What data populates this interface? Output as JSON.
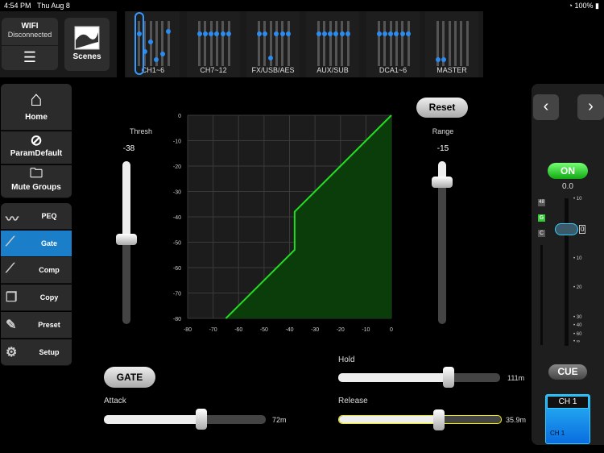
{
  "status": {
    "time": "4:54 PM",
    "date": "Thu Aug 8",
    "battery": "100%"
  },
  "top": {
    "wifi_title": "WIFI",
    "wifi_status": "Disconnected",
    "scenes": "Scenes",
    "groups": [
      {
        "label": "CH1~6",
        "levels": [
          0.75,
          0.3,
          0.55,
          0.1,
          0.25,
          0.8
        ]
      },
      {
        "label": "CH7~12",
        "levels": [
          0.75,
          0.75,
          0.75,
          0.75,
          0.75,
          0.75
        ]
      },
      {
        "label": "FX/USB/AES",
        "levels": [
          0.75,
          0.75,
          0.15,
          0.75,
          0.75,
          0.75
        ]
      },
      {
        "label": "AUX/SUB",
        "levels": [
          0.75,
          0.75,
          0.75,
          0.75,
          0.75,
          0.75
        ]
      },
      {
        "label": "DCA1~6",
        "levels": [
          0.75,
          0.75,
          0.75,
          0.75,
          0.75,
          0.75
        ]
      },
      {
        "label": "MASTER",
        "levels": [
          0.1,
          0.1,
          null,
          null,
          null,
          null
        ]
      }
    ]
  },
  "sidebar": {
    "home": "Home",
    "param": "ParamDefault",
    "mute": "Mute Groups",
    "items": [
      "PEQ",
      "Gate",
      "Comp",
      "Copy",
      "Preset",
      "Setup"
    ],
    "active": "Gate"
  },
  "gate": {
    "thresh_label": "Thresh",
    "thresh_value": "-38",
    "range_label": "Range",
    "range_value": "-15",
    "reset": "Reset",
    "gate_button": "GATE",
    "attack_label": "Attack",
    "attack_value": "72m",
    "hold_label": "Hold",
    "hold_value": "111m",
    "release_label": "Release",
    "release_value": "35.9m",
    "attack_pos": 0.6,
    "hold_pos": 0.68,
    "release_pos": 0.61,
    "thresh_pos": 0.52,
    "range_pos": 0.87
  },
  "chart_data": {
    "type": "line",
    "xlim": [
      -80,
      0
    ],
    "ylim": [
      -80,
      0
    ],
    "grid": true,
    "x_ticks": [
      "-80",
      "-70",
      "-60",
      "-50",
      "-40",
      "-30",
      "-20",
      "-10",
      "0"
    ],
    "y_ticks": [
      "0",
      "-10",
      "-20",
      "-30",
      "-40",
      "-50",
      "-60",
      "-70",
      "-80"
    ],
    "points": [
      [
        -65,
        -80
      ],
      [
        -38,
        -53
      ],
      [
        -38,
        -38
      ],
      [
        0,
        0
      ]
    ],
    "line_color": "#22dd22",
    "fill_color": "#0b3d0b"
  },
  "channel": {
    "on": "ON",
    "level": "0.0",
    "tag48": "48",
    "tagG": "G",
    "tagC": "C",
    "fader_marker": "0",
    "scale": [
      "10",
      "10",
      "20",
      "30",
      "40",
      "60",
      "∞"
    ],
    "cue": "CUE",
    "name": "CH 1",
    "sub": "CH 1",
    "prev": "‹",
    "next": "›"
  }
}
